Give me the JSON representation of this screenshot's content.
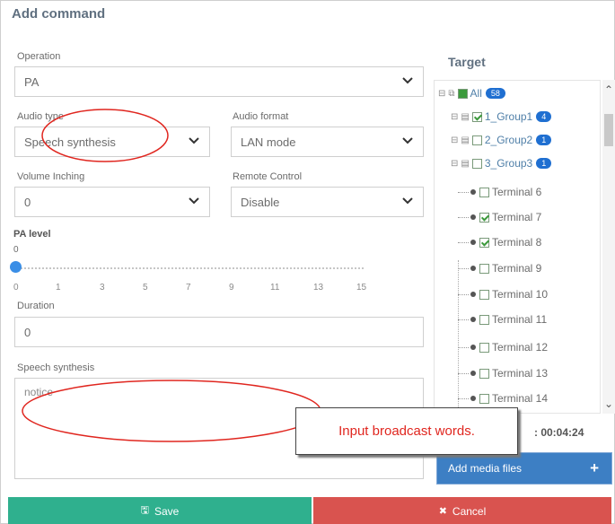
{
  "dialog": {
    "title": "Add command"
  },
  "operation": {
    "label": "Operation",
    "value": "PA"
  },
  "audio_type": {
    "label": "Audio type",
    "value": "Speech synthesis"
  },
  "audio_format": {
    "label": "Audio format",
    "value": "LAN mode"
  },
  "volume_inching": {
    "label": "Volume Inching",
    "value": "0"
  },
  "remote_control": {
    "label": "Remote Control",
    "value": "Disable"
  },
  "pa_level": {
    "label": "PA level",
    "current_value": "0",
    "min": 0,
    "max": 15,
    "value_fraction": 0,
    "ticks": [
      "0",
      "1",
      "3",
      "5",
      "7",
      "9",
      "11",
      "13",
      "15"
    ]
  },
  "duration": {
    "label": "Duration",
    "value": "0"
  },
  "speech_synthesis": {
    "label": "Speech synthesis",
    "value": "notice"
  },
  "target": {
    "title": "Target",
    "all": {
      "label": "All",
      "count": "58"
    },
    "groups": [
      {
        "label": "1_Group1",
        "count": "4",
        "checked": true
      },
      {
        "label": "2_Group2",
        "count": "1",
        "checked": false
      },
      {
        "label": "3_Group3",
        "count": "1",
        "checked": false
      }
    ],
    "terminals": [
      {
        "label": "Terminal 6",
        "checked": false
      },
      {
        "label": "Terminal 7",
        "checked": true
      },
      {
        "label": "Terminal 8",
        "checked": true
      },
      {
        "label": "Terminal 9",
        "checked": false
      },
      {
        "label": "Terminal 10",
        "checked": false
      },
      {
        "label": "Terminal 11",
        "checked": false
      },
      {
        "label": "Terminal 12",
        "checked": false
      },
      {
        "label": "Terminal 13",
        "checked": false
      },
      {
        "label": "Terminal 14",
        "checked": false
      }
    ]
  },
  "timer": {
    "text": ": 00:04:24"
  },
  "buttons": {
    "add_media": "Add media files",
    "save": "Save",
    "cancel": "Cancel"
  },
  "annotation": {
    "text": "Input broadcast words."
  },
  "colors": {
    "save": "#2fb08e",
    "cancel": "#d9534f",
    "media": "#3d7fc4",
    "annotation": "#e0261f",
    "badge": "#1f6fd1"
  }
}
